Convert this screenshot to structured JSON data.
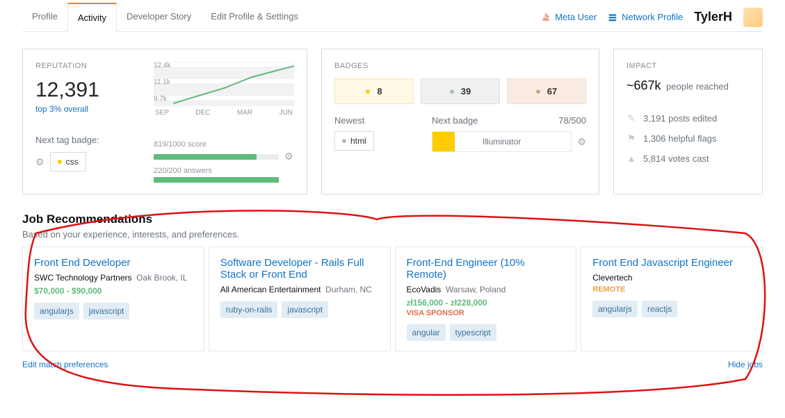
{
  "tabs": {
    "profile": "Profile",
    "activity": "Activity",
    "story": "Developer Story",
    "edit": "Edit Profile & Settings"
  },
  "topbar": {
    "meta": "Meta User",
    "network": "Network Profile",
    "username": "TylerH"
  },
  "reputation": {
    "title": "REPUTATION",
    "value": "12,391",
    "rank": "top 3% overall",
    "next_tag_label": "Next tag badge:",
    "next_tag": "css",
    "score_label": "819/1000 score",
    "answers_label": "220/200 answers",
    "chart_ticks_y": {
      "top": "12.4k",
      "mid": "11.1k",
      "bot": "9.7k"
    },
    "chart_ticks_x": {
      "a": "SEP",
      "b": "DEC",
      "c": "MAR",
      "d": "JUN"
    }
  },
  "chart_data": {
    "type": "line",
    "title": "Reputation over time",
    "xlabel": "",
    "ylabel": "reputation",
    "ylim": [
      9700,
      12400
    ],
    "categories": [
      "SEP",
      "DEC",
      "MAR",
      "JUN"
    ],
    "values": [
      9700,
      10400,
      11400,
      12390
    ]
  },
  "badges": {
    "title": "BADGES",
    "gold": "8",
    "silver": "39",
    "bronze": "67",
    "newest_label": "Newest",
    "newest_tag": "html",
    "next_label": "Next badge",
    "next_count": "78/500",
    "next_name": "Illuminator"
  },
  "impact": {
    "title": "IMPACT",
    "reach": "~667k",
    "reach_suffix": "people reached",
    "posts_edited": "3,191 posts edited",
    "helpful_flags": "1,306 helpful flags",
    "votes_cast": "5,814 votes cast"
  },
  "jobs": {
    "title": "Job Recommendations",
    "subtitle": "Based on your experience, interests, and preferences.",
    "edit_link": "Edit match preferences",
    "hide_link": "Hide jobs",
    "items": [
      {
        "title": "Front End Developer",
        "company": "SWC Technology Partners",
        "location": "Oak Brook, IL",
        "salary": "$70,000 - $90,000",
        "visa": "",
        "remote": "",
        "tags": [
          "angularjs",
          "javascript"
        ]
      },
      {
        "title": "Software Developer - Rails Full Stack or Front End",
        "company": "All American Entertainment",
        "location": "Durham, NC",
        "salary": "",
        "visa": "",
        "remote": "",
        "tags": [
          "ruby-on-rails",
          "javascript"
        ]
      },
      {
        "title": "Front-End Engineer (10% Remote)",
        "company": "EcoVadis",
        "location": "Warsaw, Poland",
        "salary": "zł156,000 - zł228,000",
        "visa": "VISA SPONSOR",
        "remote": "",
        "tags": [
          "angular",
          "typescript"
        ]
      },
      {
        "title": "Front End Javascript Engineer",
        "company": "Clevertech",
        "location": "",
        "salary": "",
        "visa": "",
        "remote": "REMOTE",
        "tags": [
          "angularjs",
          "reactjs"
        ]
      }
    ]
  }
}
